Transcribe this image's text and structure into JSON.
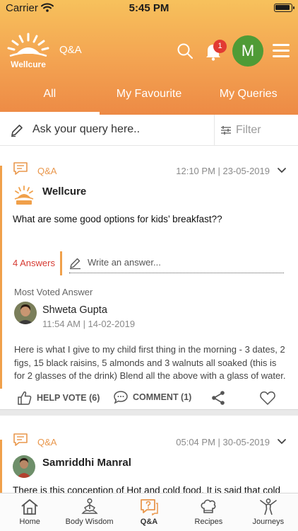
{
  "status_bar": {
    "carrier": "Carrier",
    "time": "5:45 PM"
  },
  "header": {
    "brand": "Wellcure",
    "title": "Q&A",
    "notification_count": "1",
    "avatar_initial": "M"
  },
  "tabs": [
    {
      "label": "All",
      "active": true
    },
    {
      "label": "My Favourite",
      "active": false
    },
    {
      "label": "My Queries",
      "active": false
    }
  ],
  "query_bar": {
    "placeholder": "Ask your query here..",
    "filter_label": "Filter"
  },
  "posts": [
    {
      "category": "Q&A",
      "datetime": "12:10 PM | 23-05-2019",
      "author": "Wellcure",
      "question": "What are some good options for kids’ breakfast??",
      "answers_count": "4 Answers",
      "write_placeholder": "Write an answer...",
      "most_voted_label": "Most Voted Answer",
      "answer": {
        "author": "Shweta Gupta",
        "datetime": "11:54 AM | 14-02-2019",
        "text": "Here is what I give to my child first thing in the morning - 3 dates, 2 figs, 15 black raisins, 5 almonds and 3 walnuts all soaked (this is for 2 glasses of the drink) Blend all the above with a glass of water. No need to add honey or sugar or any sweetener."
      },
      "help_vote": "HELP VOTE (6)",
      "comment": "COMMENT (1)"
    },
    {
      "category": "Q&A",
      "datetime": "05:04 PM | 30-05-2019",
      "author": "Samriddhi Manral",
      "question": "There is this conception of Hot and cold food. It is said that cold"
    }
  ],
  "tabbar": [
    {
      "label": "Home",
      "icon": "home-icon"
    },
    {
      "label": "Body Wisdom",
      "icon": "meditation-icon"
    },
    {
      "label": "Q&A",
      "icon": "qa-icon",
      "active": true
    },
    {
      "label": "Recipes",
      "icon": "chef-hat-icon"
    },
    {
      "label": "Journeys",
      "icon": "journey-icon"
    }
  ],
  "colors": {
    "accent": "#F0A04A",
    "brand_orange": "#ED8A45",
    "badge_red": "#E23A33",
    "avatar_green": "#4F9B36",
    "answers_red": "#D63A32"
  }
}
